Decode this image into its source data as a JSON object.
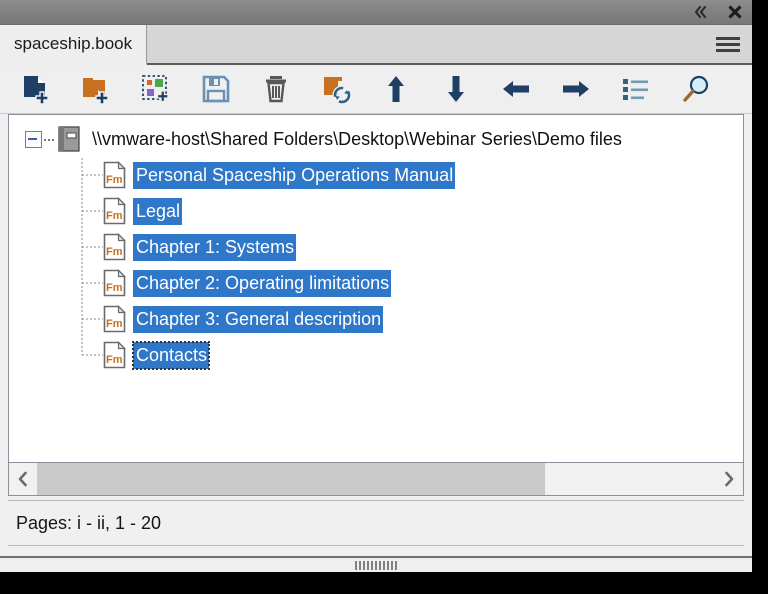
{
  "window": {
    "titlebar": {
      "collapse_label": "«",
      "collapse_icon": "chevrons-left-icon",
      "close_label": "✕",
      "close_icon": "close-icon"
    },
    "tab": {
      "active_label": "spaceship.book",
      "menu_icon": "hamburger-menu-icon"
    }
  },
  "toolbar": {
    "buttons": [
      {
        "name": "add-file-button",
        "icon": "document-add-icon",
        "label": "Add File"
      },
      {
        "name": "add-folder-button",
        "icon": "folder-add-icon",
        "label": "Add Folder"
      },
      {
        "name": "add-group-button",
        "icon": "group-add-icon",
        "label": "Add Group"
      },
      {
        "name": "save-button",
        "icon": "floppy-save-icon",
        "label": "Save"
      },
      {
        "name": "delete-button",
        "icon": "trash-icon",
        "label": "Delete"
      },
      {
        "name": "update-book-button",
        "icon": "folder-refresh-icon",
        "label": "Update Book"
      },
      {
        "name": "move-up-button",
        "icon": "arrow-up-icon",
        "label": "Move Up"
      },
      {
        "name": "move-down-button",
        "icon": "arrow-down-icon",
        "label": "Move Down"
      },
      {
        "name": "promote-button",
        "icon": "arrow-left-icon",
        "label": "Promote"
      },
      {
        "name": "demote-button",
        "icon": "arrow-right-icon",
        "label": "Demote"
      },
      {
        "name": "list-view-button",
        "icon": "list-icon",
        "label": "List View"
      },
      {
        "name": "search-button",
        "icon": "magnifier-icon",
        "label": "Search"
      }
    ]
  },
  "tree": {
    "root": {
      "label": "\\\\vmware-host\\Shared Folders\\Desktop\\Webinar Series\\Demo files",
      "icon": "book-icon",
      "expander": "minus-expander-icon",
      "expanded": true
    },
    "items": [
      {
        "label": "Personal Spaceship Operations Manual",
        "icon": "fm-document-icon",
        "selected": true,
        "focused": false
      },
      {
        "label": "Legal",
        "icon": "fm-document-icon",
        "selected": true,
        "focused": false
      },
      {
        "label": "Chapter 1: Systems",
        "icon": "fm-document-icon",
        "selected": true,
        "focused": false
      },
      {
        "label": "Chapter 2: Operating limitations",
        "icon": "fm-document-icon",
        "selected": true,
        "focused": false
      },
      {
        "label": "Chapter 3: General description",
        "icon": "fm-document-icon",
        "selected": true,
        "focused": false
      },
      {
        "label": "Contacts",
        "icon": "fm-document-icon",
        "selected": true,
        "focused": true
      }
    ]
  },
  "scrollbar": {
    "left_arrow": "‹",
    "right_arrow": "›",
    "left_icon": "chevron-left-icon",
    "right_icon": "chevron-right-icon"
  },
  "statusbar": {
    "text": "Pages: i - ii, 1 - 20"
  },
  "colors": {
    "selection_blue": "#2f77c8",
    "accent_orange": "#c7701f",
    "accent_navy": "#1f3f66",
    "titlebar_gray": "#818181"
  }
}
